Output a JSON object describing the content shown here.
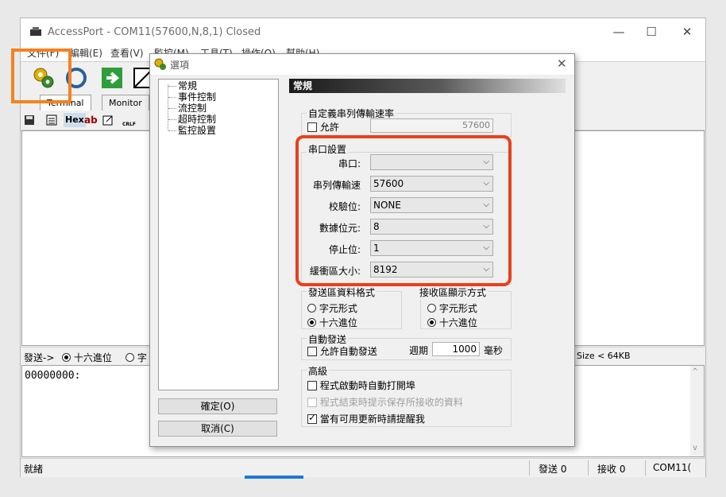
{
  "main_window": {
    "title": "AccessPort - COM11(57600,N,8,1) Closed",
    "controls": {
      "minimize": "—",
      "maximize": "☐",
      "close": "✕"
    },
    "menu": [
      "文件(F)",
      "編輯(E)",
      "查看(V)",
      "監控(M)",
      "工具(T)",
      "操作(O)",
      "幫助(H)"
    ],
    "toolbar_icons": [
      "settings-gear-icon",
      "connect-icon",
      "run-arrow-icon",
      "monitor-icon"
    ],
    "tabs": [
      "Terminal",
      "Monitor"
    ],
    "subtoolbar": {
      "hex": "Hex",
      "ab": "ab",
      "crlf": "CRLF"
    },
    "send_bar": {
      "label": "發送->",
      "option1": "十六進位",
      "option2": "字",
      "size": "Size < 64KB"
    },
    "send_content": "00000000:",
    "status": {
      "ready": "就緒",
      "sent": "發送 0",
      "received": "接收 0",
      "port": "COM11("
    }
  },
  "dialog": {
    "title": "選項",
    "tree": [
      "常規",
      "事件控制",
      "流控制",
      "超時控制",
      "監控設置"
    ],
    "ok_button": "確定(O)",
    "cancel_button": "取消(C)",
    "section_title": "常規",
    "custom_baud": {
      "title": "自定義串列傳輸速率",
      "allow": "允許",
      "value": "57600",
      "allow_checked": false
    },
    "port_settings": {
      "title": "串口設置",
      "fields": [
        {
          "label": "串口:",
          "value": ""
        },
        {
          "label": "串列傳輸速",
          "value": "57600"
        },
        {
          "label": "校驗位:",
          "value": "NONE"
        },
        {
          "label": "數據位元:",
          "value": "8"
        },
        {
          "label": "停止位:",
          "value": "1"
        },
        {
          "label": "緩衝區大小:",
          "value": "8192"
        }
      ]
    },
    "send_format": {
      "title": "發送區資料格式",
      "opt1": "字元形式",
      "opt2": "十六進位",
      "selected": "十六進位"
    },
    "recv_format": {
      "title": "接收區顯示方式",
      "opt1": "字元形式",
      "opt2": "十六進位",
      "selected": "十六進位"
    },
    "auto_send": {
      "title": "自動發送",
      "allow": "允許自動發送",
      "period_label": "週期",
      "period_value": "1000",
      "unit": "毫秒"
    },
    "advanced": {
      "title": "高級",
      "opt1": "程式啟動時自動打開埠",
      "opt2": "程式結束時提示保存所接收的資料",
      "opt3": "當有可用更新時請提醒我",
      "opt1_checked": false,
      "opt2_checked": false,
      "opt3_checked": true
    }
  },
  "highlights": {
    "toolbar_color": "#f58220",
    "port_settings_color": "#e8401c"
  }
}
